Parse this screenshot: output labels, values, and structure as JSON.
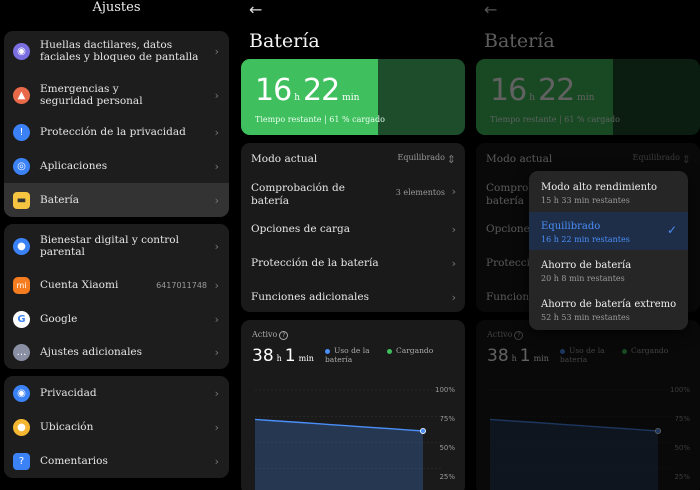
{
  "settings": {
    "title": "Ajustes",
    "group1": [
      {
        "label": "Huellas dactilares, datos faciales y bloqueo de pantalla",
        "icon": "fingerprint-icon",
        "color": "#7b6ee0"
      },
      {
        "label": "Emergencias y seguridad personal",
        "icon": "emergency-icon",
        "color": "#e86a4a"
      },
      {
        "label": "Protección de la privacidad",
        "icon": "privacy-shield-icon",
        "color": "#3b82f6"
      },
      {
        "label": "Aplicaciones",
        "icon": "apps-icon",
        "color": "#3b82f6"
      },
      {
        "label": "Batería",
        "icon": "battery-icon",
        "color": "#f5c542"
      }
    ],
    "group2": [
      {
        "label": "Bienestar digital y control parental",
        "icon": "wellbeing-icon",
        "color": "#3b82f6"
      },
      {
        "label": "Cuenta Xiaomi",
        "icon": "xiaomi-icon",
        "color": "#f57c1f",
        "value": "6417011748"
      },
      {
        "label": "Google",
        "icon": "google-icon",
        "color": "#ffffff"
      },
      {
        "label": "Ajustes adicionales",
        "icon": "more-icon",
        "color": "#8a8fa3"
      }
    ],
    "group3": [
      {
        "label": "Privacidad",
        "icon": "eye-icon",
        "color": "#3b82f6"
      },
      {
        "label": "Ubicación",
        "icon": "location-icon",
        "color": "#f5b731"
      },
      {
        "label": "Comentarios",
        "icon": "feedback-icon",
        "color": "#3b82f6"
      }
    ]
  },
  "battery": {
    "back_glyph": "←",
    "title": "Batería",
    "hours": "16",
    "hours_unit": "h",
    "minutes": "22",
    "minutes_unit": "min",
    "remaining_text": "Tiempo restante | 61 % cargado",
    "charge_percent": 61,
    "items": [
      {
        "label": "Modo actual",
        "value": "Equilibrado"
      },
      {
        "label": "Comprobación de batería",
        "value": "3 elementos"
      },
      {
        "label": "Opciones de carga",
        "value": ""
      },
      {
        "label": "Protección de la batería",
        "value": ""
      },
      {
        "label": "Funciones adicionales",
        "value": ""
      }
    ],
    "usage": {
      "header": "Activo",
      "hours": "38",
      "hours_unit": "h",
      "minutes": "1",
      "minutes_unit": "min",
      "legend_use": "Uso de la batería",
      "legend_charge": "Cargando",
      "use_color": "#4a8ef7",
      "charge_color": "#3fbf5e",
      "ticks": [
        "100%",
        "75%",
        "50%",
        "25%"
      ]
    }
  },
  "chart_data": {
    "type": "area",
    "ylim": [
      0,
      100
    ],
    "series": [
      {
        "name": "Uso de la batería",
        "values": [
          72,
          71,
          70,
          69,
          68,
          67,
          66,
          65,
          64,
          63,
          62,
          61
        ]
      }
    ]
  },
  "mode_menu": {
    "options": [
      {
        "name": "Modo alto rendimiento",
        "sub": "15 h 33 min restantes",
        "selected": false
      },
      {
        "name": "Equilibrado",
        "sub": "16 h 22 min restantes",
        "selected": true
      },
      {
        "name": "Ahorro de batería",
        "sub": "20 h 8 min restantes",
        "selected": false
      },
      {
        "name": "Ahorro de batería extremo",
        "sub": "52 h 53 min restantes",
        "selected": false
      }
    ],
    "check_glyph": "✓"
  }
}
